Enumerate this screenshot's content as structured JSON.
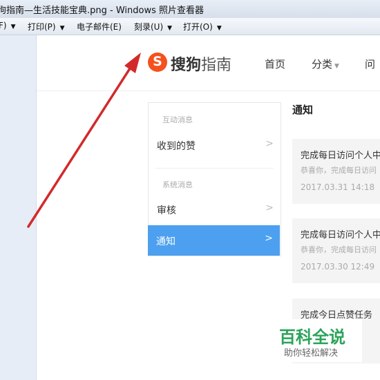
{
  "window": {
    "title": "狗指南—生活技能宝典.png - Windows 照片查看器"
  },
  "menu": [
    {
      "label": "F)"
    },
    {
      "label": "打印(P)"
    },
    {
      "label": "电子邮件(E)"
    },
    {
      "label": "刻录(U)"
    },
    {
      "label": "打开(O)"
    }
  ],
  "site": {
    "logo_mark": "S",
    "logo_bold": "搜狗",
    "logo_rest": "指南",
    "nav": [
      {
        "label": "首页"
      },
      {
        "label": "分类"
      },
      {
        "label": "问"
      }
    ]
  },
  "sidebar": {
    "section_interactive": "互动消息",
    "item_likes": "收到的赞",
    "section_system": "系统消息",
    "item_review": "审核",
    "item_notice": "通知"
  },
  "notices": {
    "title": "通知",
    "cards": [
      {
        "title": "完成每日访问个人中",
        "subtitle": "恭喜你，完成每日访问",
        "date": "2017.03.31 14:18"
      },
      {
        "title": "完成每日访问个人中",
        "subtitle": "恭喜你，完成每日访问",
        "date": "2017.03.30 12:49"
      },
      {
        "title": "完成今日点赞任务",
        "subtitle": "",
        "date": ""
      }
    ]
  },
  "watermark": {
    "main": "百科全说",
    "sub": "助你轻松解决"
  },
  "colors": {
    "accent": "#4ca0ef",
    "logo": "#f4511e",
    "arrow": "#d22a2a",
    "watermark": "#2aa35a"
  }
}
